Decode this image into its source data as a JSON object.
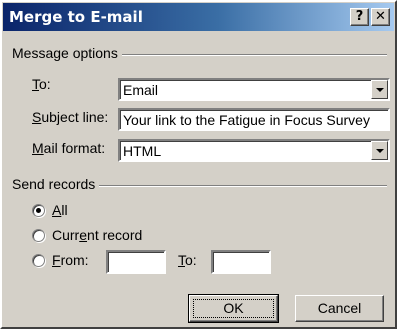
{
  "window": {
    "title": "Merge to E-mail",
    "help_label": "?",
    "close_label": "✕"
  },
  "message_options": {
    "legend": "Message options",
    "to": {
      "label_accel": "T",
      "label_rest": "o:",
      "value": "Email"
    },
    "subject": {
      "label_accel": "S",
      "label_rest": "ubject line:",
      "value": "Your link to the Fatigue in Focus Survey"
    },
    "format": {
      "label_accel": "M",
      "label_rest": "ail format:",
      "value": "HTML"
    }
  },
  "send_records": {
    "legend": "Send records",
    "selected": "all",
    "all": {
      "label_accel": "A",
      "label_rest": "ll"
    },
    "current": {
      "label_pre": "Curr",
      "label_accel": "e",
      "label_rest": "nt record"
    },
    "from": {
      "label_accel": "F",
      "label_rest": "rom:",
      "value": ""
    },
    "to": {
      "label_accel": "T",
      "label_rest": "o:",
      "value": ""
    }
  },
  "buttons": {
    "ok": "OK",
    "cancel": "Cancel"
  }
}
